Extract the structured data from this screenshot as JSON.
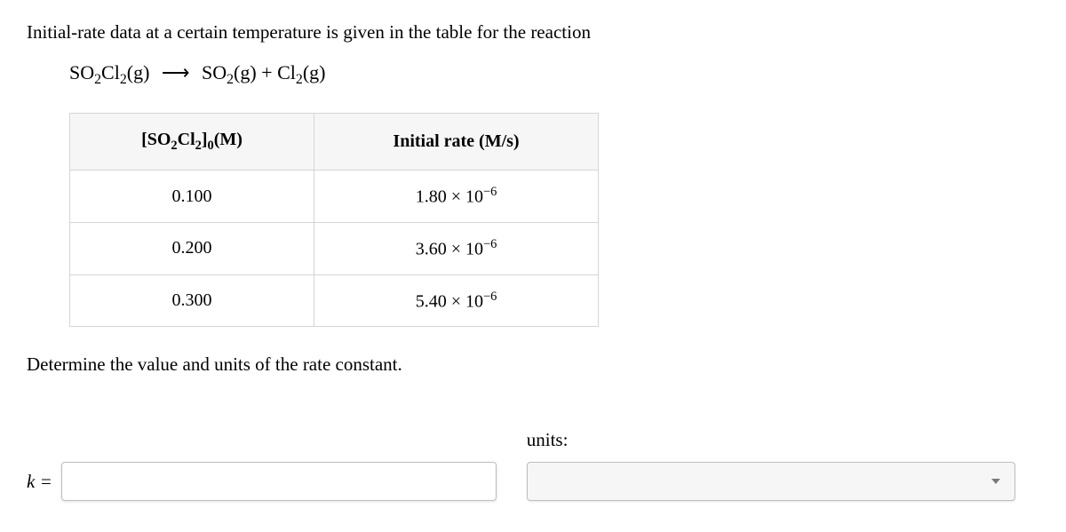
{
  "intro": "Initial-rate data at a certain temperature is given in the table for the reaction",
  "reaction": {
    "reactant": "SO₂Cl₂(g)",
    "arrow": "⟶",
    "product1": "SO₂(g)",
    "plus": "+",
    "product2": "Cl₂(g)"
  },
  "table": {
    "header_conc": "[SO₂Cl₂]₀(M)",
    "header_rate": "Initial rate (M/s)",
    "rows": [
      {
        "conc": "0.100",
        "rate": "1.80 × 10⁻⁶"
      },
      {
        "conc": "0.200",
        "rate": "3.60 × 10⁻⁶"
      },
      {
        "conc": "0.300",
        "rate": "5.40 × 10⁻⁶"
      }
    ]
  },
  "instruction": "Determine the value and units of the rate constant.",
  "answer": {
    "k_label_prefix": "k",
    "k_label_eq": " =",
    "k_value": "",
    "units_label": "units:",
    "units_value": ""
  }
}
